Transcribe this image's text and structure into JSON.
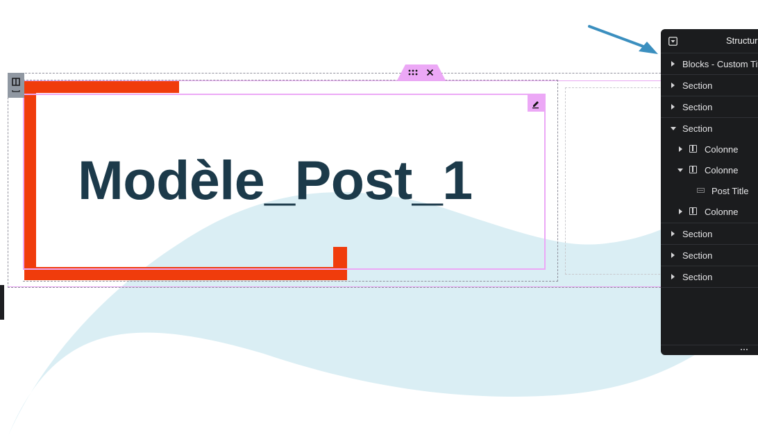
{
  "canvas": {
    "post_title": "Modèle_Post_1",
    "colors": {
      "title": "#1c3a4a",
      "accent_orange": "#f03c0c",
      "wave": "#daeef4",
      "selection_pink": "#eca8f6",
      "annotation_arrow": "#3b8fbf"
    },
    "section_handle": {
      "drag_icon": "drag-handle-icon",
      "close_icon": "close-icon"
    },
    "column_handle_icon": "column-icon",
    "edit_widget_icon": "pencil-icon"
  },
  "structure_panel": {
    "title": "Structure",
    "collapse_icon": "collapse-icon",
    "items": [
      {
        "label": "Blocks - Custom Title",
        "type": "section",
        "expanded": false
      },
      {
        "label": "Section",
        "type": "section",
        "expanded": false
      },
      {
        "label": "Section",
        "type": "section",
        "expanded": false
      },
      {
        "label": "Section",
        "type": "section",
        "expanded": true,
        "children": [
          {
            "label": "Colonne",
            "type": "column",
            "expanded": false
          },
          {
            "label": "Colonne",
            "type": "column",
            "expanded": true,
            "children": [
              {
                "label": "Post Title",
                "type": "widget"
              }
            ]
          },
          {
            "label": "Colonne",
            "type": "column",
            "expanded": false
          }
        ]
      },
      {
        "label": "Section",
        "type": "section",
        "expanded": false
      },
      {
        "label": "Section",
        "type": "section",
        "expanded": false
      },
      {
        "label": "Section",
        "type": "section",
        "expanded": false
      }
    ],
    "footer_icon": "more-icon"
  }
}
